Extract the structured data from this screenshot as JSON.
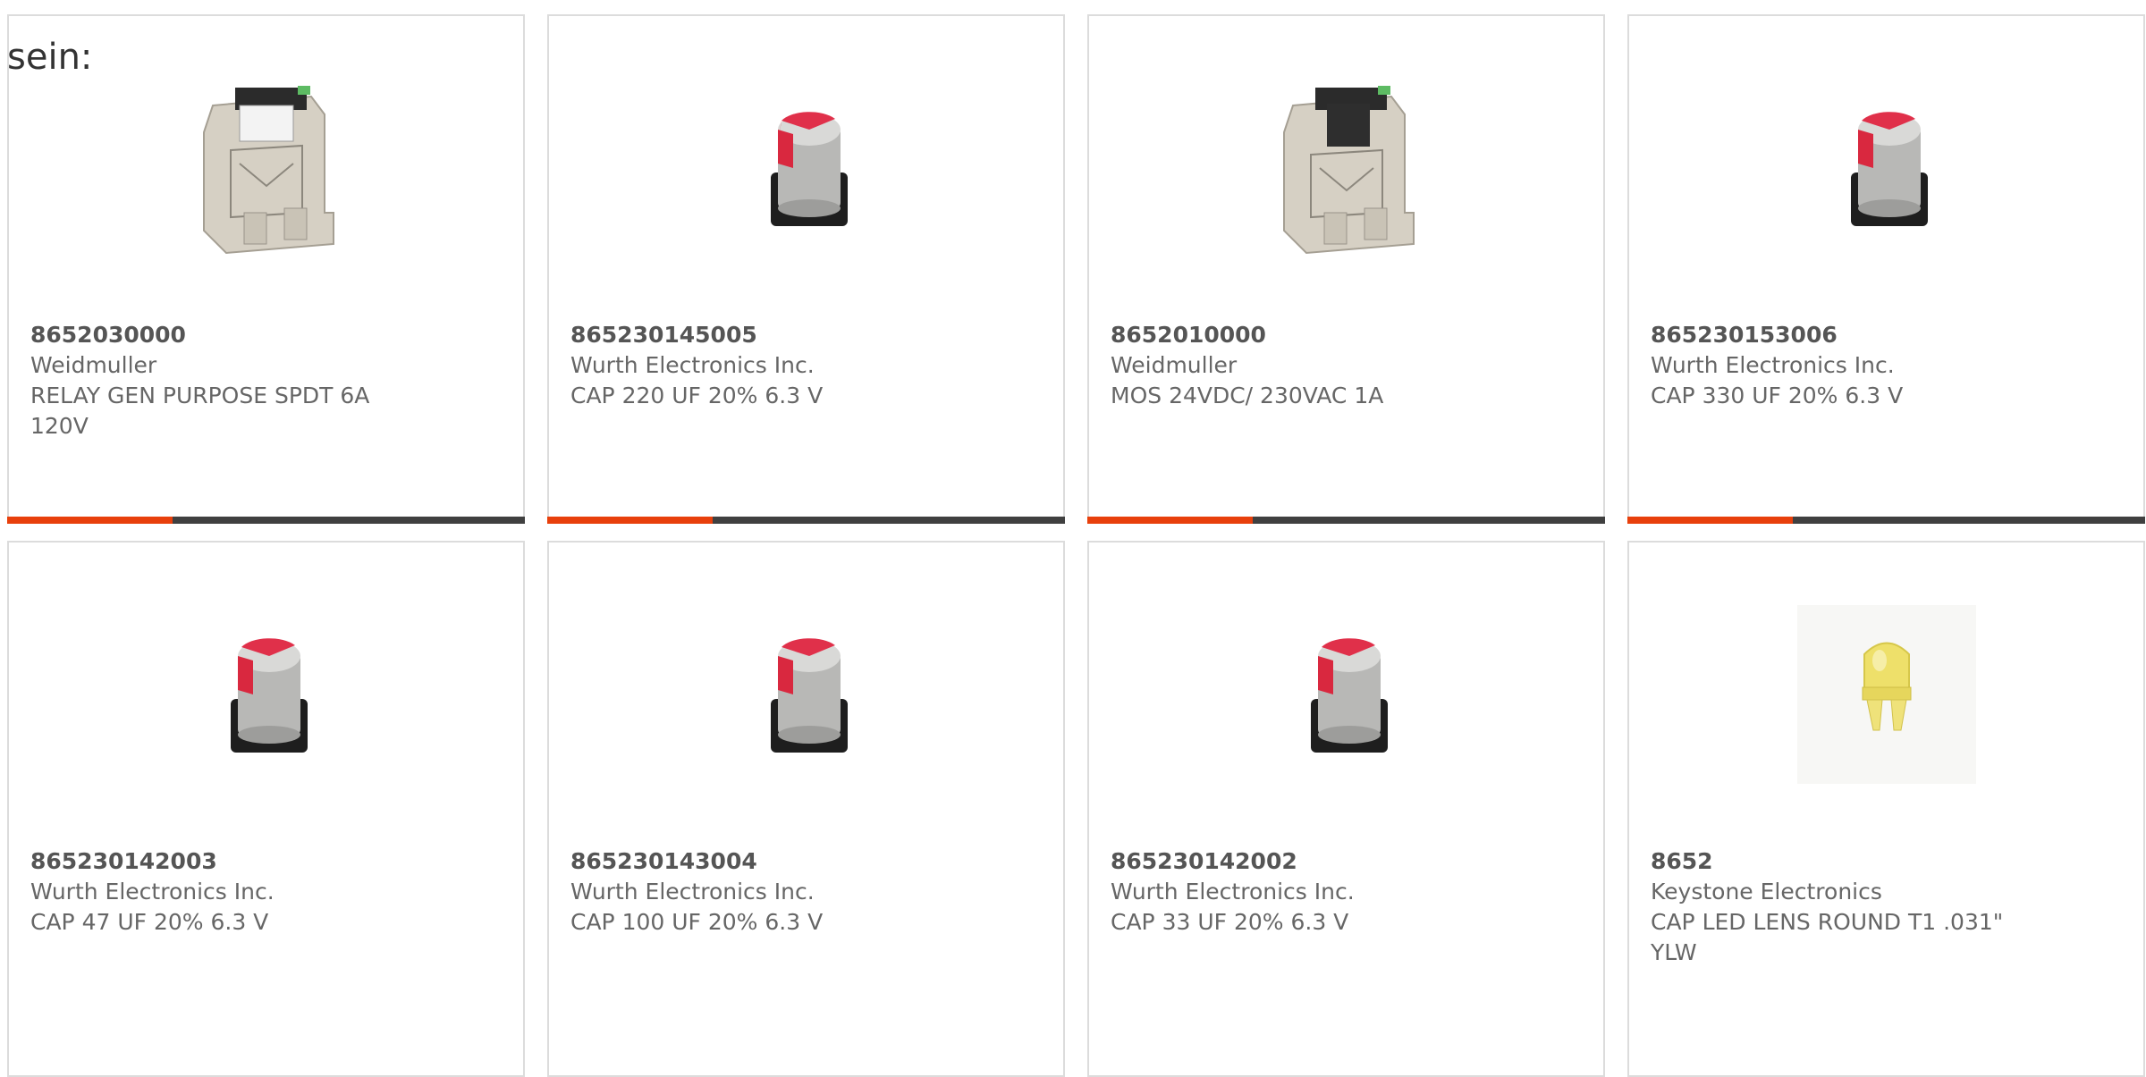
{
  "page": {
    "label": "sein:",
    "accent_color": "#e8400c",
    "bar_color": "#404040"
  },
  "products": [
    {
      "part_number": "8652030000",
      "manufacturer": "Weidmuller",
      "description": "RELAY GEN PURPOSE SPDT 6A 120V",
      "image": "relay-image",
      "progress": 0.32
    },
    {
      "part_number": "865230145005",
      "manufacturer": "Wurth Electronics Inc.",
      "description": "CAP 220 UF 20% 6.3 V",
      "image": "capacitor-image",
      "progress": 0.32
    },
    {
      "part_number": "8652010000",
      "manufacturer": "Weidmuller",
      "description": "MOS 24VDC/ 230VAC 1A",
      "image": "relay-image",
      "progress": 0.32
    },
    {
      "part_number": "865230153006",
      "manufacturer": "Wurth Electronics Inc.",
      "description": "CAP 330 UF 20% 6.3 V",
      "image": "capacitor-image",
      "progress": 0.32
    },
    {
      "part_number": "865230142003",
      "manufacturer": "Wurth Electronics Inc.",
      "description": "CAP 47 UF 20% 6.3 V",
      "image": "capacitor-image"
    },
    {
      "part_number": "865230143004",
      "manufacturer": "Wurth Electronics Inc.",
      "description": "CAP 100 UF 20% 6.3 V",
      "image": "capacitor-image"
    },
    {
      "part_number": "865230142002",
      "manufacturer": "Wurth Electronics Inc.",
      "description": "CAP 33 UF 20% 6.3 V",
      "image": "capacitor-image"
    },
    {
      "part_number": "8652",
      "manufacturer": "Keystone Electronics",
      "description": "CAP LED LENS ROUND T1 .031\" YLW",
      "image": "led-lens-image"
    }
  ]
}
